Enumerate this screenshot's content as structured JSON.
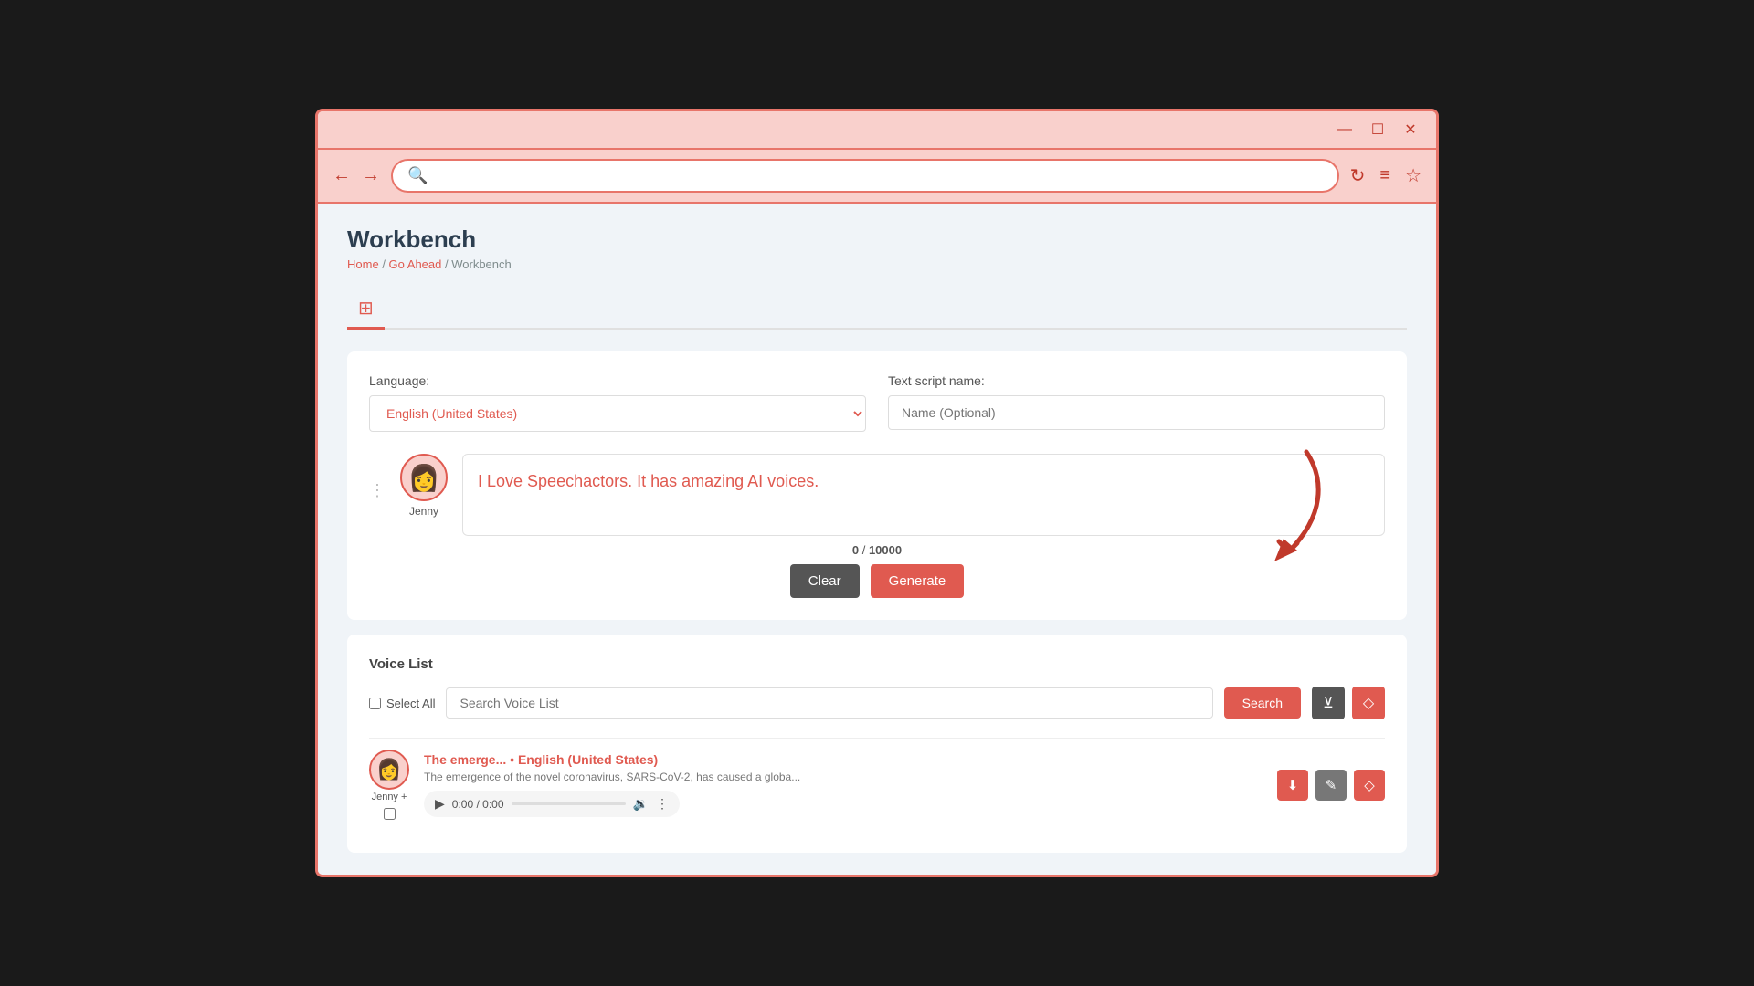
{
  "titleBar": {
    "minimizeIcon": "—",
    "maximizeIcon": "☐",
    "closeIcon": "✕"
  },
  "navBar": {
    "backIcon": "←",
    "forwardIcon": "→",
    "searchPlaceholder": "",
    "searchIconLabel": "search-icon",
    "reloadIcon": "↻",
    "menuIcon": "≡",
    "bookmarkIcon": "☆"
  },
  "page": {
    "title": "Workbench",
    "breadcrumb": {
      "home": "Home",
      "separator1": " / ",
      "goAhead": "Go Ahead",
      "separator2": " / ",
      "current": "Workbench"
    }
  },
  "form": {
    "languageLabel": "Language:",
    "languageValue": "English (United States)",
    "scriptNameLabel": "Text script name:",
    "scriptNamePlaceholder": "Name (Optional)",
    "voiceName": "Jenny",
    "textContent": "I Love Speechactors. It has amazing AI voices.",
    "charCount": "0",
    "charMax": "10000",
    "clearLabel": "Clear",
    "generateLabel": "Generate"
  },
  "voiceList": {
    "sectionTitle": "Voice List",
    "selectAllLabel": "Select All",
    "searchPlaceholder": "Search Voice List",
    "searchLabel": "Search",
    "filterIconLabel": "filter-icon",
    "deleteIconLabel": "delete-icon",
    "items": [
      {
        "name": "Jenny +",
        "title": "The emerge...",
        "language": "English (United States)",
        "description": "The emergence of the novel coronavirus, SARS-CoV-2, has caused a globa...",
        "audioTime": "0:00 / 0:00"
      }
    ]
  }
}
